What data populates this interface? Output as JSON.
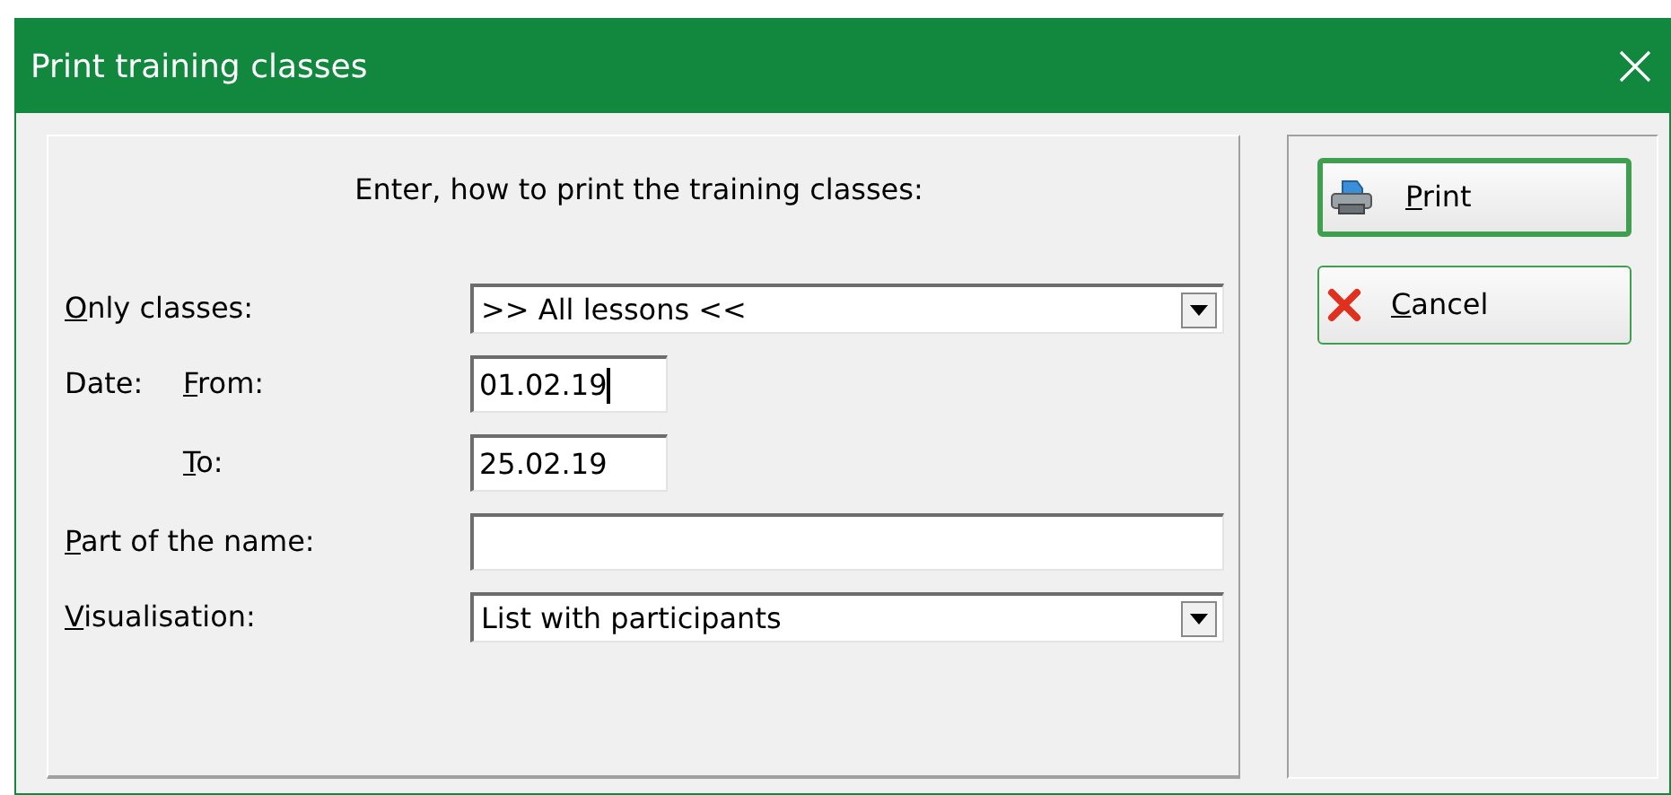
{
  "window": {
    "title": "Print training classes"
  },
  "instruction": "Enter, how to print the training classes:",
  "fields": [
    {
      "kind": "dropdown",
      "label": "Only classes:",
      "value": ">> All lessons <<",
      "focused": false
    },
    {
      "kind": "date",
      "group_label": "Date:",
      "label": "From:",
      "value": "01.02.19",
      "focused": true
    },
    {
      "kind": "date",
      "label": "To:",
      "value": "25.02.19",
      "focused": false
    },
    {
      "kind": "text",
      "label": "Part of the name:",
      "focused": false
    },
    {
      "kind": "dropdown",
      "label": "Visualisation:",
      "value": "List with participants",
      "focused": false
    }
  ],
  "buttons": [
    {
      "kind": "print",
      "label": "Print",
      "default": true
    },
    {
      "kind": "cancel",
      "label": "Cancel",
      "default": false
    }
  ]
}
